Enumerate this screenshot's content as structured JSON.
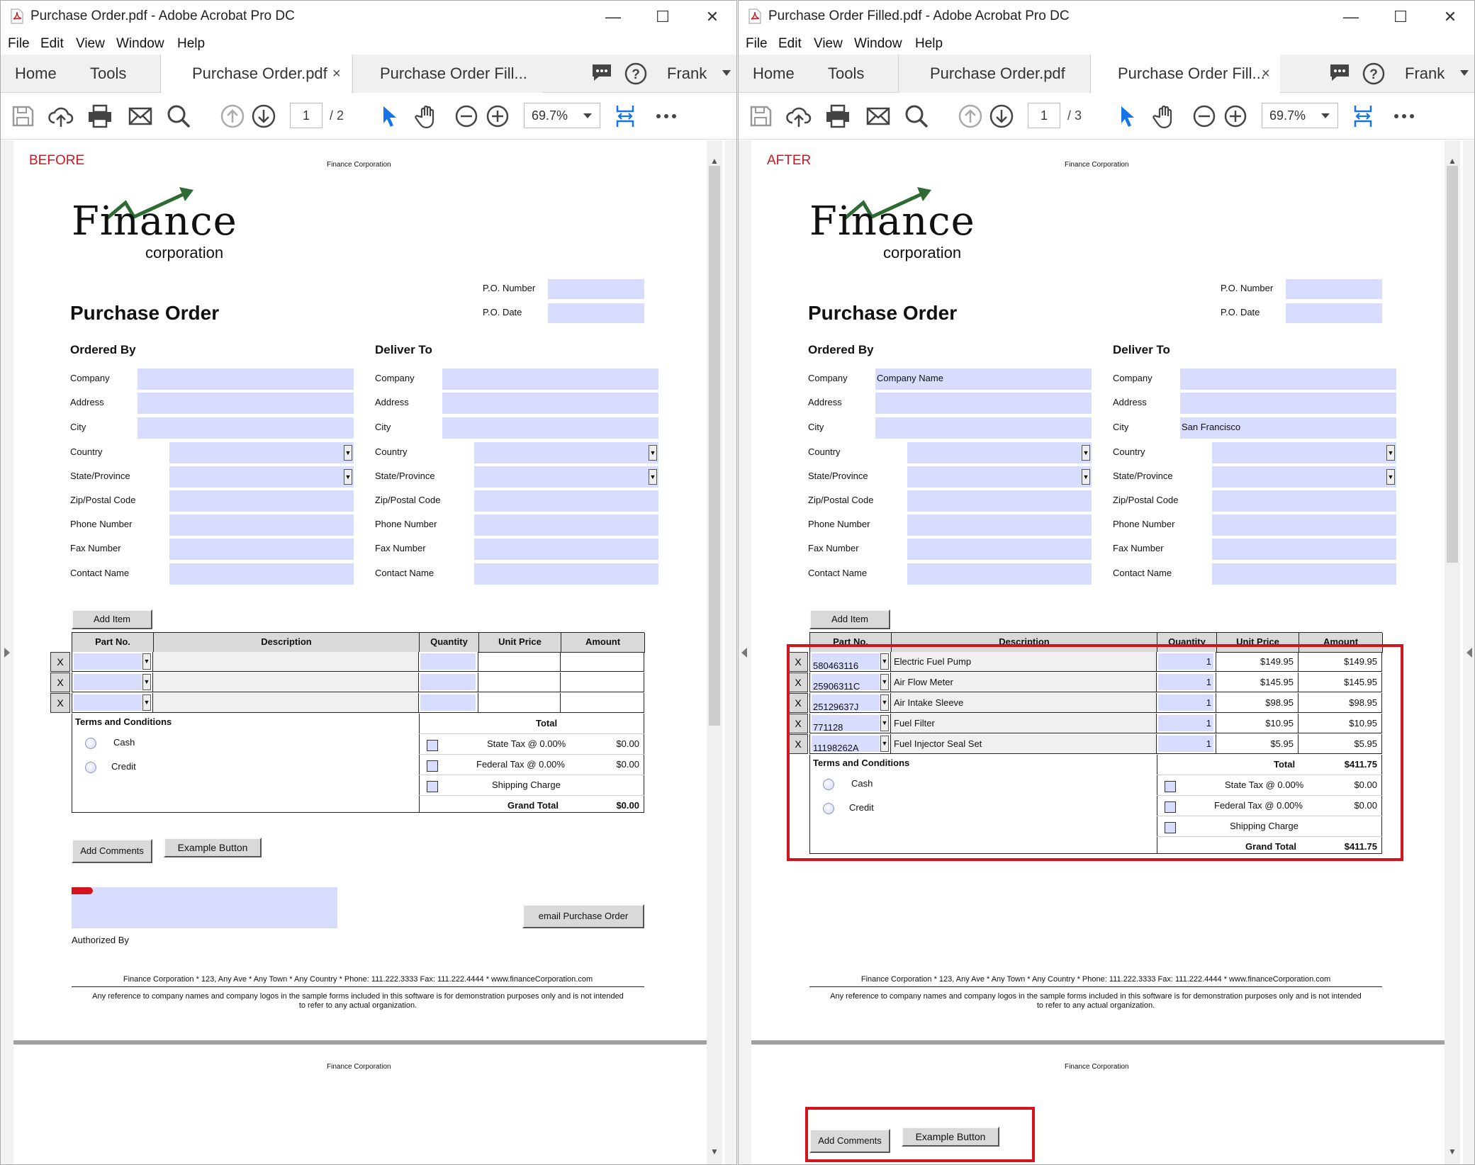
{
  "left": {
    "window_title": "Purchase Order.pdf - Adobe Acrobat Pro DC",
    "tab1": "Purchase Order.pdf",
    "tab2": "Purchase Order Fill...",
    "page_current": "1",
    "page_total": "/ 2",
    "zoom": "69.7%",
    "stamp": "BEFORE"
  },
  "right": {
    "window_title": "Purchase Order Filled.pdf - Adobe Acrobat Pro DC",
    "tab1": "Purchase Order.pdf",
    "tab2": "Purchase Order Fill...",
    "page_current": "1",
    "page_total": "/ 3",
    "zoom": "69.7%",
    "stamp": "AFTER"
  },
  "menu": {
    "file": "File",
    "edit": "Edit",
    "view": "View",
    "window": "Window",
    "help": "Help"
  },
  "nav": {
    "home": "Home",
    "tools": "Tools",
    "user": "Frank",
    "close_tab": "×",
    "min": "—",
    "max": "☐",
    "close": "✕"
  },
  "form": {
    "company_header": "Finance Corporation",
    "logo_word": "Finance",
    "logo_sub": "corporation",
    "title": "Purchase Order",
    "po_number": "P.O. Number",
    "po_date": "P.O. Date",
    "ordered_by": "Ordered By",
    "deliver_to": "Deliver To",
    "company": "Company",
    "address": "Address",
    "city": "City",
    "country": "Country",
    "state": "State/Province",
    "zip": "Zip/Postal Code",
    "phone": "Phone Number",
    "fax": "Fax Number",
    "contact": "Contact Name",
    "add_item": "Add Item",
    "col_part": "Part No.",
    "col_desc": "Description",
    "col_qty": "Quantity",
    "col_unit": "Unit Price",
    "col_amount": "Amount",
    "x": "X",
    "terms": "Terms and Conditions",
    "cash": "Cash",
    "credit": "Credit",
    "total": "Total",
    "state_tax": "State Tax @ 0.00%",
    "federal_tax": "Federal Tax @ 0.00%",
    "shipping": "Shipping Charge",
    "grand_total": "Grand Total",
    "add_comments": "Add Comments",
    "example_button": "Example Button",
    "email_po": "email Purchase Order",
    "authorized_by": "Authorized By",
    "footer1": "Finance Corporation * 123, Any Ave * Any Town * Any Country * Phone: 111.222.3333 Fax: 111.222.4444 * www.financeCorporation.com",
    "footer2": "Any reference to company names and company logos in the sample forms included in this software is for demonstration purposes only and is not intended",
    "footer3": "to refer to any actual organization.",
    "page2_header": "Finance Corporation"
  },
  "before_values": {
    "state_tax": "$0.00",
    "federal_tax": "$0.00",
    "grand_total": "$0.00"
  },
  "after_values": {
    "company": "Company Name",
    "deliver_city": "San Francisco",
    "items": [
      {
        "part": "580463116",
        "desc": "Electric Fuel Pump",
        "qty": "1",
        "unit": "$149.95",
        "amount": "$149.95"
      },
      {
        "part": "25906311C",
        "desc": "Air Flow Meter",
        "qty": "1",
        "unit": "$145.95",
        "amount": "$145.95"
      },
      {
        "part": "25129637J",
        "desc": "Air Intake Sleeve",
        "qty": "1",
        "unit": "$98.95",
        "amount": "$98.95"
      },
      {
        "part": "771128",
        "desc": "Fuel Filter",
        "qty": "1",
        "unit": "$10.95",
        "amount": "$10.95"
      },
      {
        "part": "11198262A",
        "desc": "Fuel Injector Seal Set",
        "qty": "1",
        "unit": "$5.95",
        "amount": "$5.95"
      }
    ],
    "total": "$411.75",
    "state_tax": "$0.00",
    "federal_tax": "$0.00",
    "grand_total": "$411.75"
  },
  "colors": {
    "field": "#d8dcff",
    "stamp": "#d4141c",
    "arrow_green": "#2e6b34",
    "toolbar_blue": "#1473e6"
  }
}
